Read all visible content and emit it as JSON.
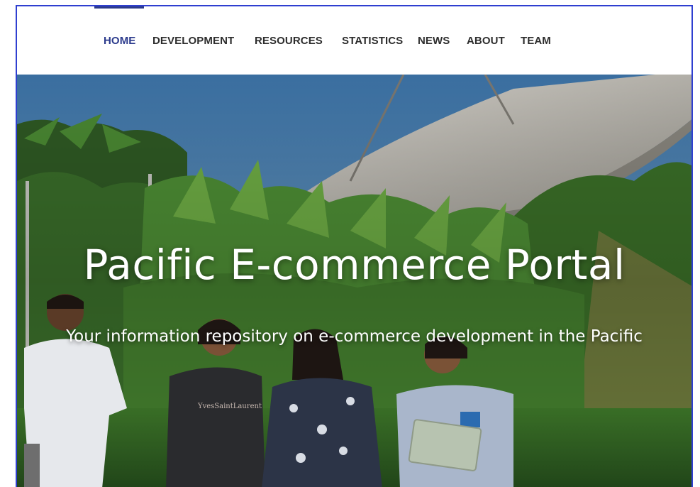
{
  "nav": {
    "items": [
      {
        "label": "HOME",
        "active": true
      },
      {
        "label": "DEVELOPMENT",
        "active": false
      },
      {
        "label": "RESOURCES",
        "active": false
      },
      {
        "label": "STATISTICS",
        "active": false
      },
      {
        "label": "NEWS",
        "active": false
      },
      {
        "label": "ABOUT",
        "active": false
      },
      {
        "label": "TEAM",
        "active": false
      }
    ]
  },
  "hero": {
    "title": "Pacific E-commerce Portal",
    "subtitle": "Your information repository on e-commerce development in the Pacific",
    "image_description_icon": "students-walking-photo",
    "sweater_text": "YvesSaintLaurent"
  },
  "colors": {
    "accent": "#2b3a8c",
    "frame_border": "#2f3fd0",
    "nav_text": "#2d2d2d"
  }
}
